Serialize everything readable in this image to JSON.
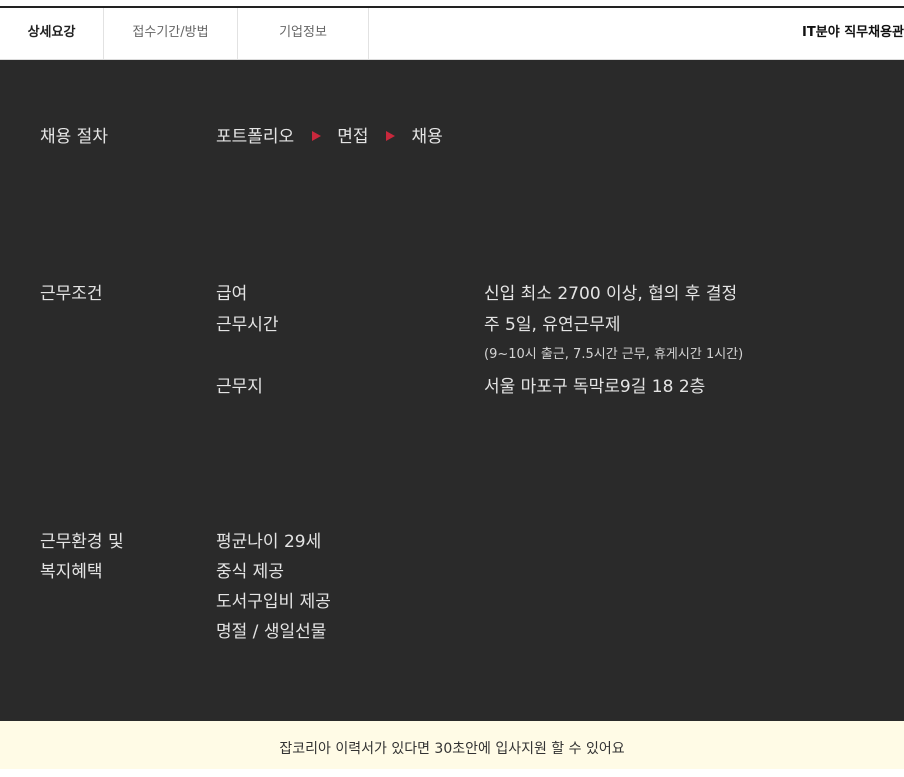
{
  "tabs": [
    {
      "label": "상세요강",
      "active": true
    },
    {
      "label": "접수기간/방법",
      "active": false
    },
    {
      "label": "기업정보",
      "active": false
    }
  ],
  "header_title": "IT분야 직무채용관",
  "process": {
    "label": "채용 절차",
    "steps": [
      "포트폴리오",
      "면접",
      "채용"
    ]
  },
  "conditions": {
    "label": "근무조건",
    "salary": {
      "label": "급여",
      "value": "신입 최소 2700 이상, 협의 후 결정"
    },
    "hours": {
      "label": "근무시간",
      "value": "주 5일, 유연근무제",
      "note": "(9~10시 출근, 7.5시간 근무, 휴게시간 1시간)"
    },
    "location": {
      "label": "근무지",
      "value": "서울 마포구 독막로9길 18 2층"
    }
  },
  "welfare": {
    "label_line1": "근무환경 및",
    "label_line2": "복지혜택",
    "items": [
      "평균나이 29세",
      "중식 제공",
      "도서구입비 제공",
      "명절 / 생일선물"
    ]
  },
  "bottom_banner": "잡코리아 이력서가 있다면 30초안에 입사지원 할 수 있어요",
  "colors": {
    "dark_bg": "#2a2a2a",
    "accent_arrow": "#c8283c",
    "banner_bg": "#fffbe6"
  }
}
